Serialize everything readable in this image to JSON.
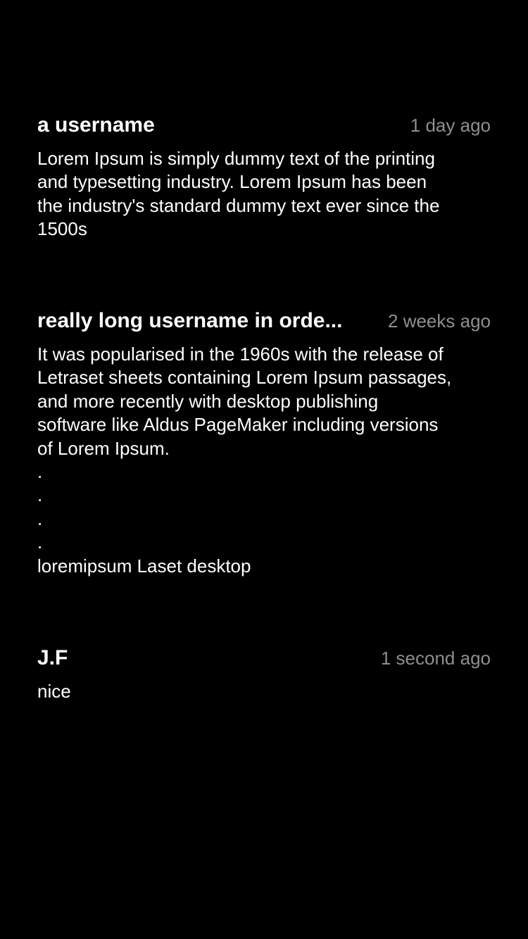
{
  "comments": [
    {
      "username": "a username",
      "time": "1 day ago",
      "lines": [
        "Lorem Ipsum is simply dummy text of the printing",
        "and typesetting industry. Lorem Ipsum has been",
        "the industry's standard dummy text ever since the",
        "1500s"
      ]
    },
    {
      "username": "really long username in orde...",
      "time": "2 weeks ago",
      "lines": [
        "It was popularised in the 1960s with the release of",
        "Letraset sheets containing Lorem Ipsum passages,",
        "and more recently with desktop publishing",
        "software like Aldus PageMaker including versions",
        "of Lorem Ipsum.",
        ".",
        ".",
        ".",
        ".",
        "loremipsum Laset desktop"
      ]
    },
    {
      "username": "J.F",
      "time": "1 second ago",
      "lines": [
        "nice"
      ]
    }
  ]
}
